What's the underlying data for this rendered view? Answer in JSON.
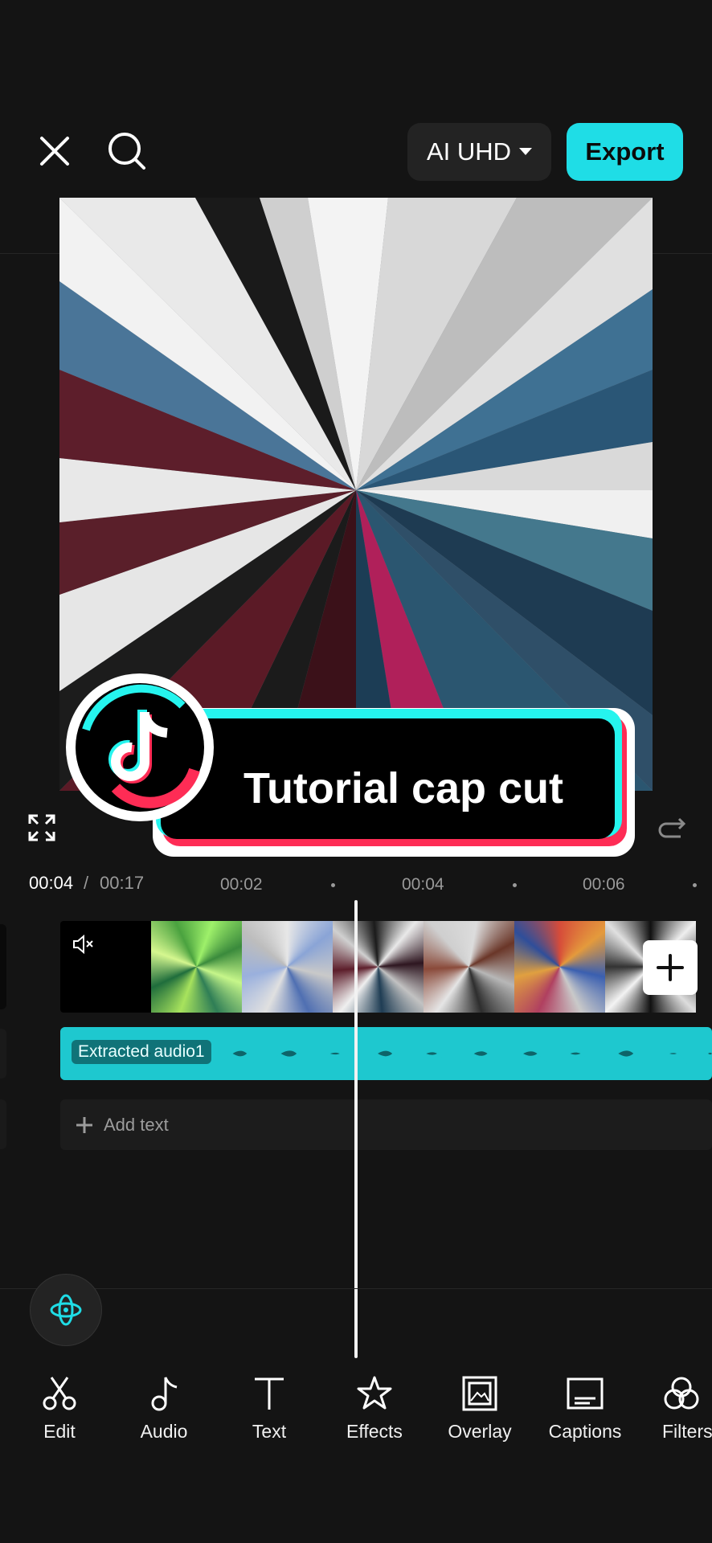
{
  "topbar": {
    "quality_label": "AI UHD",
    "export_label": "Export"
  },
  "sticker": {
    "text": "Tutorial cap cut"
  },
  "timeline": {
    "current_time": "00:04",
    "separator": "/",
    "total_time": "00:17",
    "ticks": [
      "00:02",
      "00:04",
      "00:06"
    ]
  },
  "tracks": {
    "audio_label": "Extracted audio1",
    "add_text_label": "Add text"
  },
  "toolbar": {
    "items": [
      {
        "label": "Edit",
        "icon": "scissors-icon"
      },
      {
        "label": "Audio",
        "icon": "music-note-icon"
      },
      {
        "label": "Text",
        "icon": "text-icon"
      },
      {
        "label": "Effects",
        "icon": "star-icon"
      },
      {
        "label": "Overlay",
        "icon": "overlay-icon"
      },
      {
        "label": "Captions",
        "icon": "captions-icon"
      },
      {
        "label": "Filters",
        "icon": "filters-icon"
      }
    ]
  },
  "colors": {
    "accent": "#1fdde6",
    "background": "#141414",
    "tiktok_pink": "#fe2c55"
  }
}
